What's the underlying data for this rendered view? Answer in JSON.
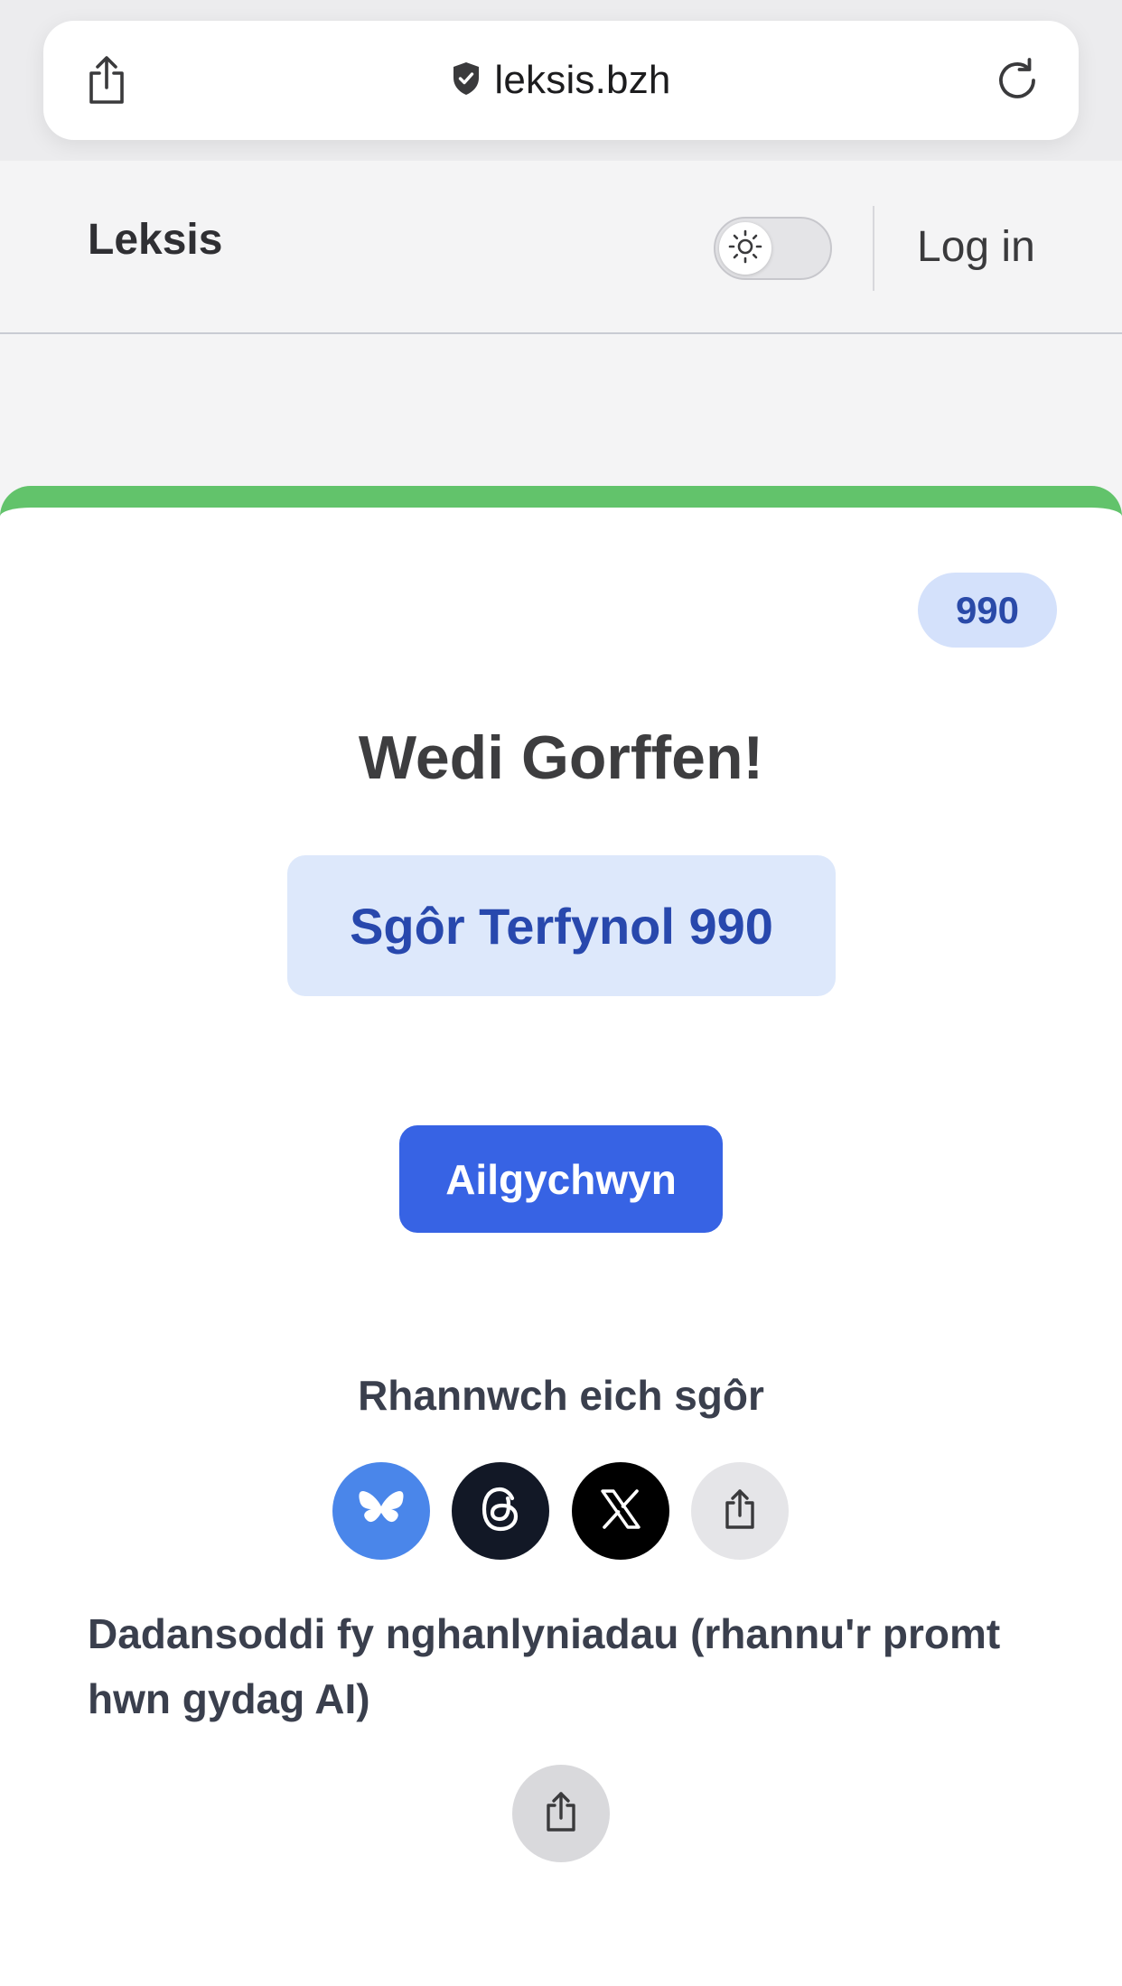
{
  "browser": {
    "url": "leksis.bzh"
  },
  "header": {
    "brand": "Leksis",
    "login_label": "Log in",
    "theme_mode": "light"
  },
  "card": {
    "score_badge": "990",
    "title": "Wedi Gorffen!",
    "final_score": "Sgôr Terfynol 990",
    "restart_label": "Ailgychwyn",
    "share_title": "Rhannwch eich sgôr",
    "share_buttons": [
      {
        "icon": "bluesky-icon",
        "color": "#4a86ea"
      },
      {
        "icon": "threads-icon",
        "color": "#121826"
      },
      {
        "icon": "x-icon",
        "color": "#000000"
      },
      {
        "icon": "share-icon",
        "color": "#e5e5e8"
      }
    ],
    "analyse_text": "Dadansoddi fy nghanlyniadau (rhannu'r promt hwn gydag AI)"
  },
  "colors": {
    "accent_bar": "#62c36b",
    "primary": "#3763e4",
    "badge_bg": "#d4e1fb"
  }
}
